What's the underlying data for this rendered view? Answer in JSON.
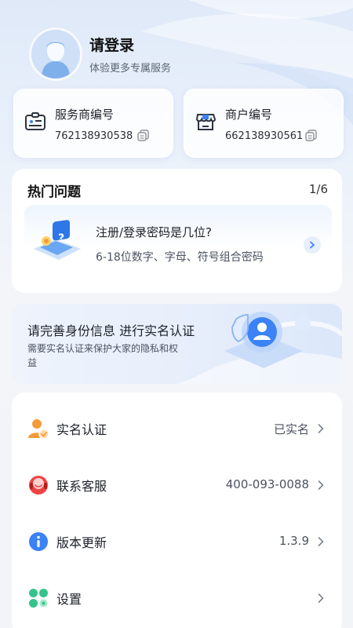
{
  "header": {
    "title": "请登录",
    "subtitle": "体验更多专属服务"
  },
  "codes": [
    {
      "label": "服务商编号",
      "value": "762138930538",
      "icon": "id-card-icon"
    },
    {
      "label": "商户编号",
      "value": "662138930561",
      "icon": "storefront-icon"
    }
  ],
  "faq": {
    "title": "热门问题",
    "counter": "1/6",
    "question": "注册/登录密码是几位?",
    "answer": "6-18位数字、字母、符号组合密码"
  },
  "banner": {
    "title": "请完善身份信息 进行实名认证",
    "subtitle": "需要实名认证来保护大家的隐私和权益"
  },
  "menu": [
    {
      "label": "实名认证",
      "value": "已实名",
      "icon": "user-verified-icon"
    },
    {
      "label": "联系客服",
      "value": "400-093-0088",
      "icon": "headset-icon"
    },
    {
      "label": "版本更新",
      "value": "1.3.9",
      "icon": "info-icon"
    },
    {
      "label": "设置",
      "value": "",
      "icon": "settings-grid-icon"
    }
  ],
  "colors": {
    "accent": "#3b82f6",
    "orange": "#f59a3c",
    "red": "#ef4444",
    "green": "#34c48b"
  }
}
